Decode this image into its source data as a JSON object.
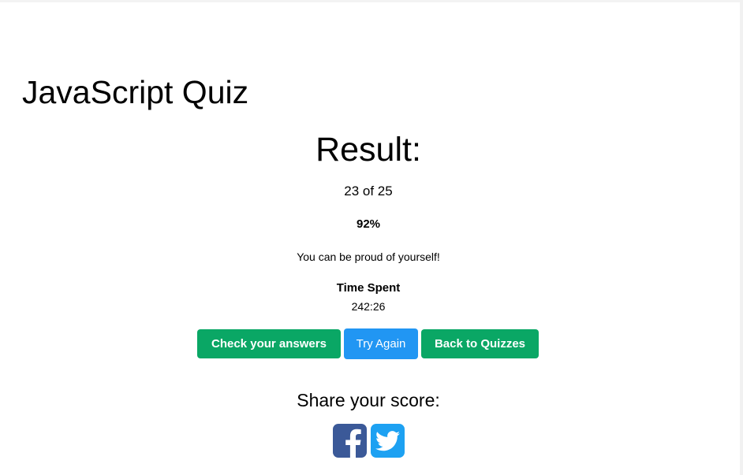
{
  "quiz": {
    "title": "JavaScript Quiz"
  },
  "result": {
    "heading": "Result:",
    "score_text": "23 of 25",
    "correct": 23,
    "total": 25,
    "percent": "92%",
    "message": "You can be proud of yourself!",
    "time_label": "Time Spent",
    "time_value": "242:26"
  },
  "actions": {
    "check_label": "Check your answers",
    "try_again_label": "Try Again",
    "back_label": "Back to Quizzes"
  },
  "share": {
    "heading": "Share your score:",
    "icons": [
      "facebook-icon",
      "twitter-icon"
    ]
  },
  "colors": {
    "primary_green": "#0aa765",
    "primary_blue": "#2196f3",
    "facebook": "#3b5998",
    "twitter": "#1da1f2"
  }
}
